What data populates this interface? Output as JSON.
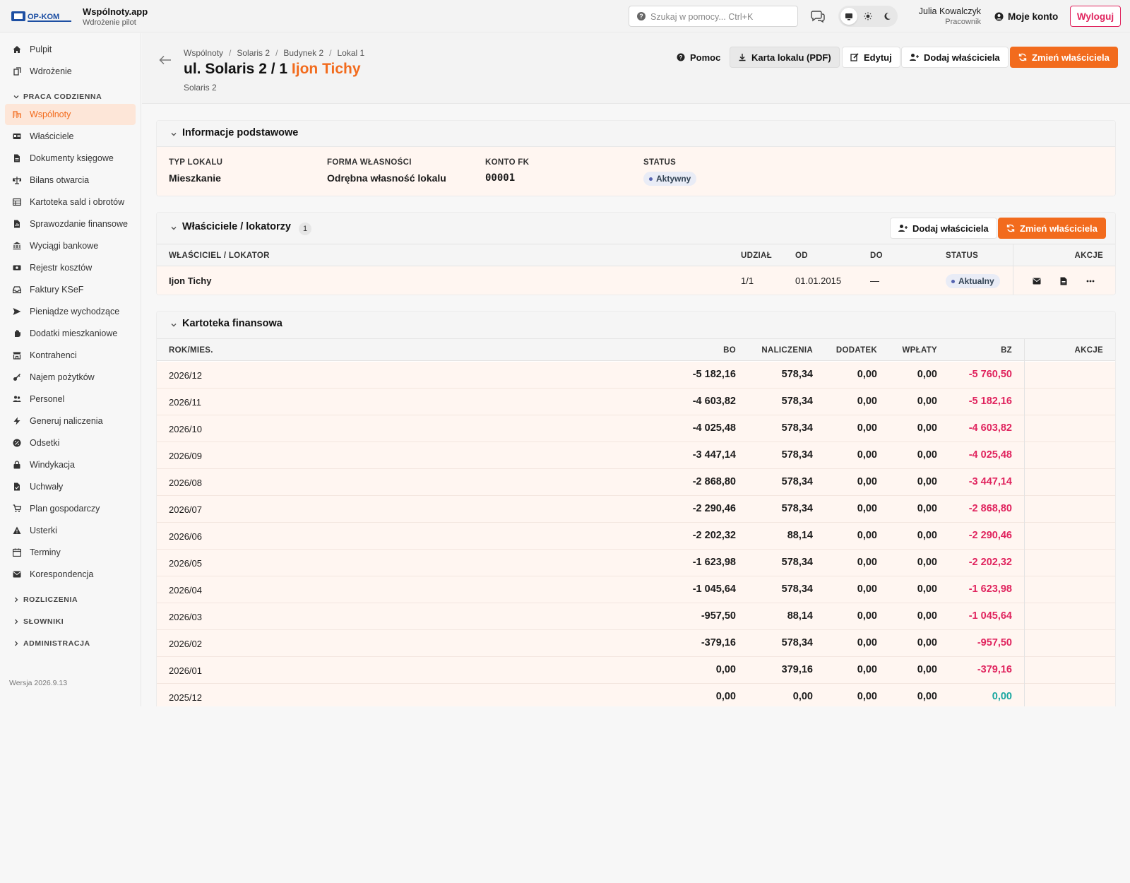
{
  "app": {
    "title": "Wspólnoty.app",
    "subtitle": "Wdrożenie pilot",
    "logo_text": "OP-KOM"
  },
  "topbar": {
    "search_placeholder": "Szukaj w pomocy... Ctrl+K",
    "user_name": "Julia Kowalczyk",
    "user_role": "Pracownik",
    "account_label": "Moje konto",
    "logout_label": "Wyloguj"
  },
  "sidebar": {
    "top_items": [
      {
        "label": "Pulpit",
        "icon": "home-icon"
      },
      {
        "label": "Wdrożenie",
        "icon": "rocket-icon"
      }
    ],
    "section_daily": "PRACA CODZIENNA",
    "items": [
      {
        "label": "Wspólnoty",
        "icon": "building-icon",
        "active": true
      },
      {
        "label": "Właściciele",
        "icon": "id-card-icon"
      },
      {
        "label": "Dokumenty księgowe",
        "icon": "document-icon"
      },
      {
        "label": "Bilans otwarcia",
        "icon": "scale-icon"
      },
      {
        "label": "Kartoteka sald i obrotów",
        "icon": "table-icon"
      },
      {
        "label": "Sprawozdanie finansowe",
        "icon": "report-icon"
      },
      {
        "label": "Wyciągi bankowe",
        "icon": "bank-icon"
      },
      {
        "label": "Rejestr kosztów",
        "icon": "money-icon"
      },
      {
        "label": "Faktury KSeF",
        "icon": "inbox-icon"
      },
      {
        "label": "Pieniądze wychodzące",
        "icon": "send-icon"
      },
      {
        "label": "Dodatki mieszkaniowe",
        "icon": "hand-icon"
      },
      {
        "label": "Kontrahenci",
        "icon": "store-icon"
      },
      {
        "label": "Najem pożytków",
        "icon": "key-icon"
      },
      {
        "label": "Personel",
        "icon": "users-icon"
      },
      {
        "label": "Generuj naliczenia",
        "icon": "bolt-icon"
      },
      {
        "label": "Odsetki",
        "icon": "percent-icon"
      },
      {
        "label": "Windykacja",
        "icon": "lock-icon"
      },
      {
        "label": "Uchwały",
        "icon": "check-file-icon"
      },
      {
        "label": "Plan gospodarczy",
        "icon": "cart-icon"
      },
      {
        "label": "Usterki",
        "icon": "warning-icon"
      },
      {
        "label": "Terminy",
        "icon": "calendar-icon"
      },
      {
        "label": "Korespondencja",
        "icon": "envelope-icon"
      }
    ],
    "sections_collapsed": [
      "ROZLICZENIA",
      "SŁOWNIKI",
      "ADMINISTRACJA"
    ],
    "version": "Wersja 2026.9.13"
  },
  "page": {
    "breadcrumb": [
      "Wspólnoty",
      "Solaris 2",
      "Budynek 2",
      "Lokal 1"
    ],
    "title_prefix": "ul. Solaris 2 / 1",
    "title_accent": "Ijon Tichy",
    "subtitle": "Solaris 2",
    "buttons": {
      "help": "Pomoc",
      "card_pdf": "Karta lokalu (PDF)",
      "edit": "Edytuj",
      "add_owner": "Dodaj właściciela",
      "change_owner": "Zmień właściciela"
    }
  },
  "basic_info": {
    "title": "Informacje podstawowe",
    "fields": [
      {
        "label": "TYP LOKALU",
        "value": "Mieszkanie"
      },
      {
        "label": "FORMA WŁASNOŚCI",
        "value": "Odrębna własność lokalu"
      },
      {
        "label": "KONTO FK",
        "value": "00001"
      },
      {
        "label": "STATUS",
        "value": "Aktywny"
      }
    ]
  },
  "owners": {
    "title": "Właściciele / lokatorzy",
    "count": "1",
    "add_label": "Dodaj właściciela",
    "change_label": "Zmień właściciela",
    "columns": [
      "WŁAŚCICIEL / LOKATOR",
      "UDZIAŁ",
      "OD",
      "DO",
      "STATUS",
      "AKCJE"
    ],
    "rows": [
      {
        "name": "Ijon Tichy",
        "share": "1/1",
        "from": "01.01.2015",
        "to": "—",
        "status": "Aktualny"
      }
    ]
  },
  "finance": {
    "title": "Kartoteka finansowa",
    "columns": [
      "ROK/MIES.",
      "BO",
      "NALICZENIA",
      "DODATEK",
      "WPŁATY",
      "BZ",
      "AKCJE"
    ],
    "rows": [
      {
        "period": "2026/12",
        "bo": "-5 182,16",
        "nal": "578,34",
        "dod": "0,00",
        "wpl": "0,00",
        "bz": "-5 760,50"
      },
      {
        "period": "2026/11",
        "bo": "-4 603,82",
        "nal": "578,34",
        "dod": "0,00",
        "wpl": "0,00",
        "bz": "-5 182,16"
      },
      {
        "period": "2026/10",
        "bo": "-4 025,48",
        "nal": "578,34",
        "dod": "0,00",
        "wpl": "0,00",
        "bz": "-4 603,82"
      },
      {
        "period": "2026/09",
        "bo": "-3 447,14",
        "nal": "578,34",
        "dod": "0,00",
        "wpl": "0,00",
        "bz": "-4 025,48"
      },
      {
        "period": "2026/08",
        "bo": "-2 868,80",
        "nal": "578,34",
        "dod": "0,00",
        "wpl": "0,00",
        "bz": "-3 447,14"
      },
      {
        "period": "2026/07",
        "bo": "-2 290,46",
        "nal": "578,34",
        "dod": "0,00",
        "wpl": "0,00",
        "bz": "-2 868,80"
      },
      {
        "period": "2026/06",
        "bo": "-2 202,32",
        "nal": "88,14",
        "dod": "0,00",
        "wpl": "0,00",
        "bz": "-2 290,46"
      },
      {
        "period": "2026/05",
        "bo": "-1 623,98",
        "nal": "578,34",
        "dod": "0,00",
        "wpl": "0,00",
        "bz": "-2 202,32"
      },
      {
        "period": "2026/04",
        "bo": "-1 045,64",
        "nal": "578,34",
        "dod": "0,00",
        "wpl": "0,00",
        "bz": "-1 623,98"
      },
      {
        "period": "2026/03",
        "bo": "-957,50",
        "nal": "88,14",
        "dod": "0,00",
        "wpl": "0,00",
        "bz": "-1 045,64"
      },
      {
        "period": "2026/02",
        "bo": "-379,16",
        "nal": "578,34",
        "dod": "0,00",
        "wpl": "0,00",
        "bz": "-957,50"
      },
      {
        "period": "2026/01",
        "bo": "0,00",
        "nal": "379,16",
        "dod": "0,00",
        "wpl": "0,00",
        "bz": "-379,16"
      },
      {
        "period": "2025/12",
        "bo": "0,00",
        "nal": "0,00",
        "dod": "0,00",
        "wpl": "0,00",
        "bz": "0,00"
      }
    ]
  },
  "colors": {
    "accent": "#f26b1d",
    "negative": "#e0245e",
    "zero": "#1aa7a0",
    "row_tint": "#fff6f1"
  }
}
